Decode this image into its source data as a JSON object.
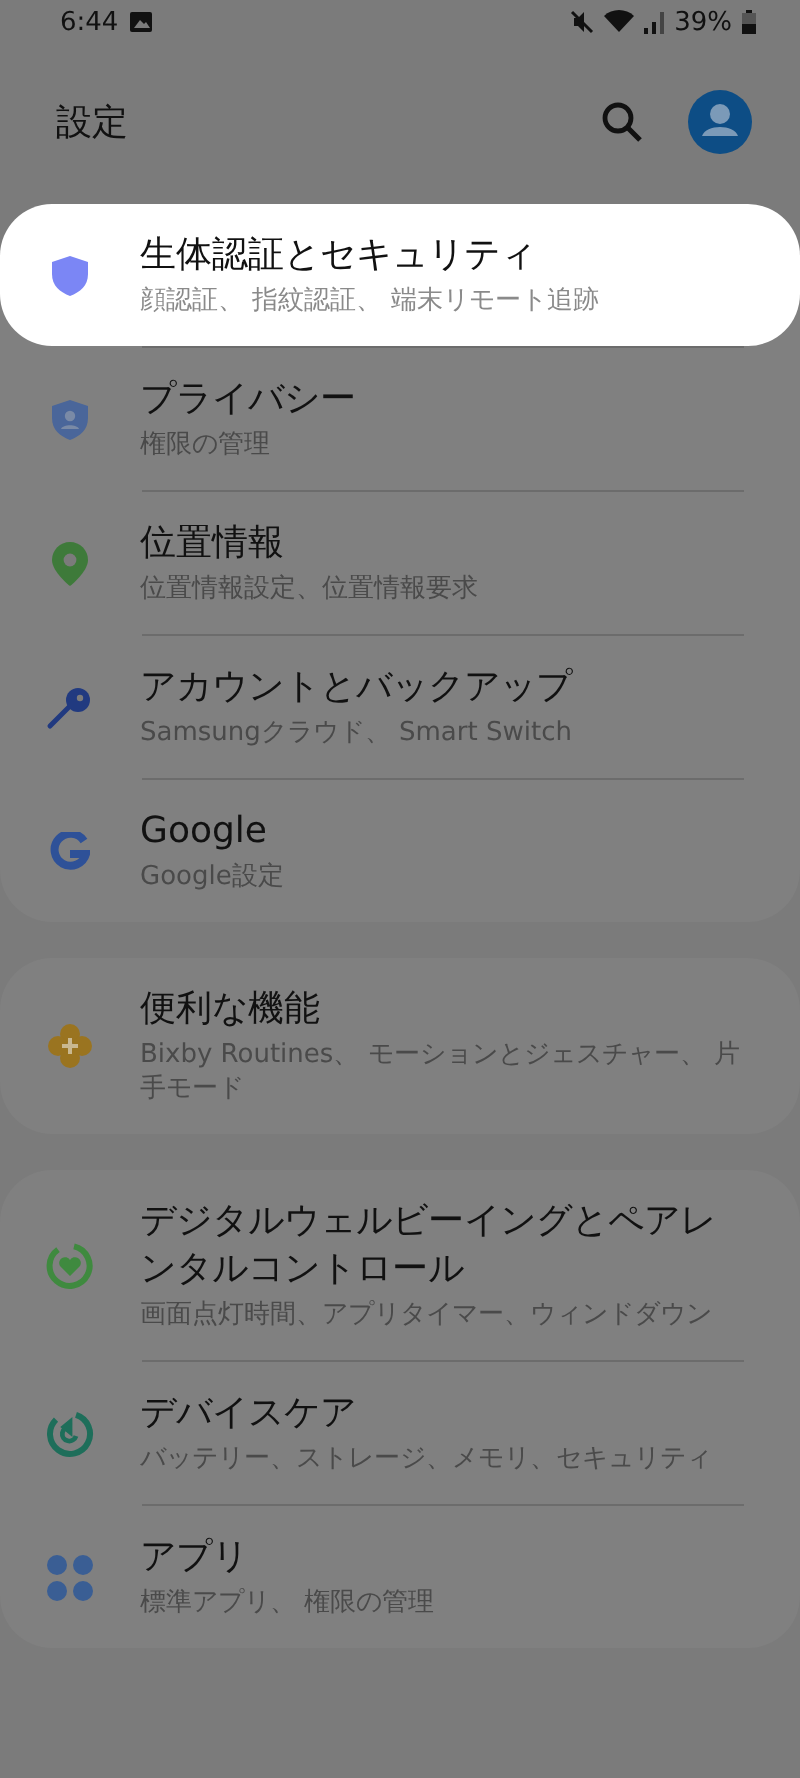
{
  "status_bar": {
    "time": "6:44",
    "battery": "39%"
  },
  "header": {
    "title": "設定"
  },
  "groups": [
    {
      "items": [
        {
          "kind": "shield",
          "title": "生体認証とセキュリティ",
          "subtitle": "顔認証、 指紋認証、 端末リモート追跡",
          "selected": true
        },
        {
          "kind": "privacy",
          "title": "プライバシー",
          "subtitle": "権限の管理",
          "selected": false
        },
        {
          "kind": "pin",
          "title": "位置情報",
          "subtitle": "位置情報設定、位置情報要求",
          "selected": false
        },
        {
          "kind": "key",
          "title": "アカウントとバックアップ",
          "subtitle": "Samsungクラウド、 Smart Switch",
          "selected": false
        },
        {
          "kind": "google",
          "title": "Google",
          "subtitle": "Google設定",
          "selected": false
        }
      ]
    },
    {
      "items": [
        {
          "kind": "puzzle",
          "title": "便利な機能",
          "subtitle": "Bixby Routines、 モーションとジェスチャー、 片手モード",
          "selected": false
        }
      ]
    },
    {
      "items": [
        {
          "kind": "wellbeing",
          "title": "デジタルウェルビーイングとペアレンタルコントロール",
          "subtitle": "画面点灯時間、アプリタイマー、ウィンドダウン",
          "selected": false
        },
        {
          "kind": "care",
          "title": "デバイスケア",
          "subtitle": "バッテリー、ストレージ、メモリ、セキュリティ",
          "selected": false
        },
        {
          "kind": "apps",
          "title": "アプリ",
          "subtitle": "標準アプリ、 権限の管理",
          "selected": false
        }
      ]
    }
  ]
}
